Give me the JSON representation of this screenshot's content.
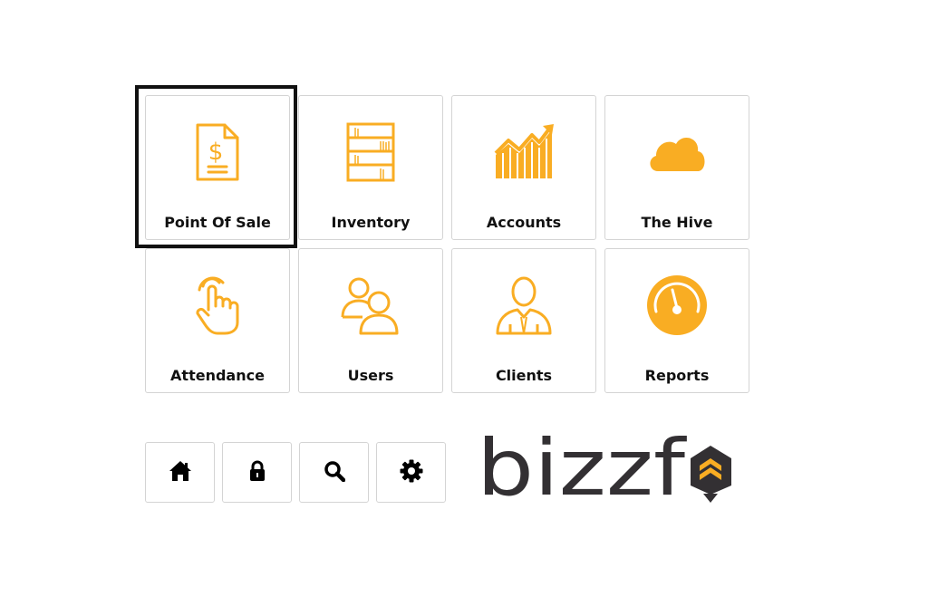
{
  "tiles": [
    {
      "label": "Point Of Sale",
      "icon": "pos-receipt-icon",
      "selected": true
    },
    {
      "label": "Inventory",
      "icon": "bookshelf-icon"
    },
    {
      "label": "Accounts",
      "icon": "growth-chart-icon"
    },
    {
      "label": "The Hive",
      "icon": "cloud-icon"
    },
    {
      "label": "Attendance",
      "icon": "pointing-hand-icon"
    },
    {
      "label": "Users",
      "icon": "users-icon"
    },
    {
      "label": "Clients",
      "icon": "client-icon"
    },
    {
      "label": "Reports",
      "icon": "gauge-icon"
    }
  ],
  "toolbar": {
    "home_icon": "home-icon",
    "lock_icon": "lock-icon",
    "search_icon": "search-icon",
    "settings_icon": "gear-icon"
  },
  "logo": {
    "text": "bizzf",
    "icon": "bee-shield-icon"
  },
  "colors": {
    "accent": "#F9AD23",
    "text": "#111111",
    "logo_text": "#333033",
    "border": "#d4d4d4"
  }
}
